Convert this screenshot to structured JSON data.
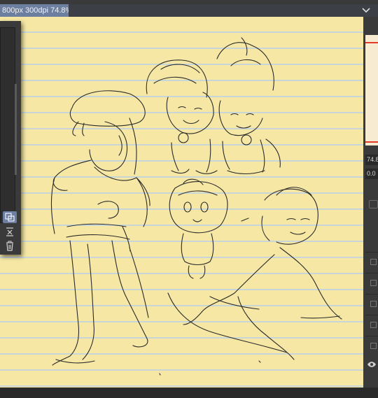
{
  "document_tab": {
    "title": "800px 300dpi 74.8%)"
  },
  "side_panel_fields": {
    "zoom_value": "74.8",
    "rotation_value": "0.0"
  },
  "icons": {
    "tab_menu": "chevron-down-icon",
    "layer_settings": "layer-settings-icon",
    "merge_down": "merge-down-icon",
    "delete": "trash-icon",
    "visibility": "eye-icon"
  },
  "colors": {
    "paper": "#f6e8a4",
    "paper_lines": "#c9d6d8",
    "sketch_ink": "#2a2a2a",
    "tab_active": "#6c7fa0",
    "accent_red": "#e03a2a"
  }
}
